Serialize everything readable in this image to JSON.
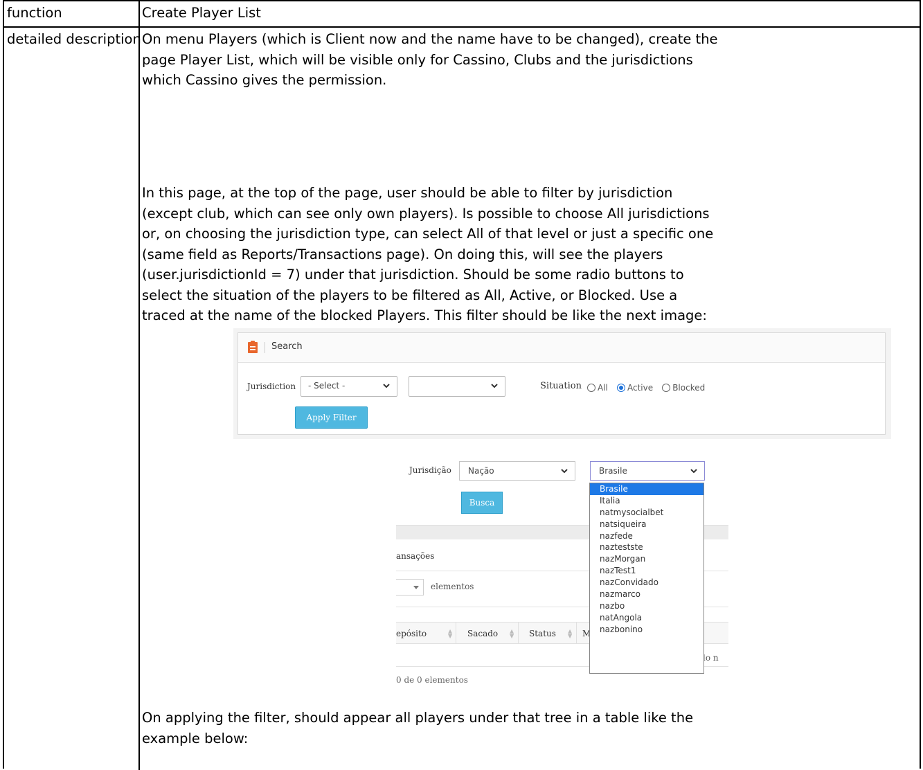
{
  "table": {
    "function_label": "function",
    "function_value": "Create Player List",
    "description_label": "detailed description"
  },
  "description": {
    "para1": [
      "On menu Players (which is Client now and the name have to be changed), create the",
      "page Player List, which will be visible only for Cassino, Clubs and the jurisdictions",
      "which Cassino gives the permission."
    ],
    "para2": [
      "In this page, at the top of the page, user should be able to filter by jurisdiction",
      "(except club, which can see only own players). Is possible to choose All jurisdictions",
      "or, on choosing the jurisdiction type, can select All of that level or just a specific one",
      "(same field as Reports/Transactions page). On doing this, will see the players",
      "(user.jurisdictionId = 7) under that jurisdiction. Should be some radio buttons to",
      "select the situation of the players to be filtered as All, Active, or Blocked. Use a",
      "traced at the name of the blocked Players. This filter should be like the next image:"
    ],
    "para3": [
      "On applying the filter, should appear all players under that tree in a table like the",
      "example below:"
    ]
  },
  "search_filter": {
    "header": "Search",
    "jurisdiction_label": "Jurisdiction",
    "select1_value": "- Select -",
    "select2_value": "",
    "situation_label": "Situation",
    "radios": [
      {
        "label": "All",
        "checked": false
      },
      {
        "label": "Active",
        "checked": true
      },
      {
        "label": "Blocked",
        "checked": false
      }
    ],
    "apply_button": "Apply Filter",
    "accent_color": "#4fb8e0",
    "icon_color": "#e8662c"
  },
  "transactions": {
    "jurisdiction_label": "Jurisdição",
    "select1_value": "Nação",
    "select2_value": "Brasile",
    "search_button": "Busca",
    "panel_title": "ansações",
    "length_label": "elementos",
    "columns": [
      "epósito",
      "Sacado",
      "Status",
      "M"
    ],
    "empty_text": "ado n",
    "info": "0 de 0 elementos",
    "dropdown_options": [
      "Brasile",
      "Italia",
      "natmysocialbet",
      "natsiqueira",
      "nazfede",
      "naztestste",
      "nazMorgan",
      "nazTest1",
      "nazConvidado",
      "nazmarco",
      "nazbo",
      "natAngola",
      "nazbonino"
    ],
    "selected_option": 0
  }
}
